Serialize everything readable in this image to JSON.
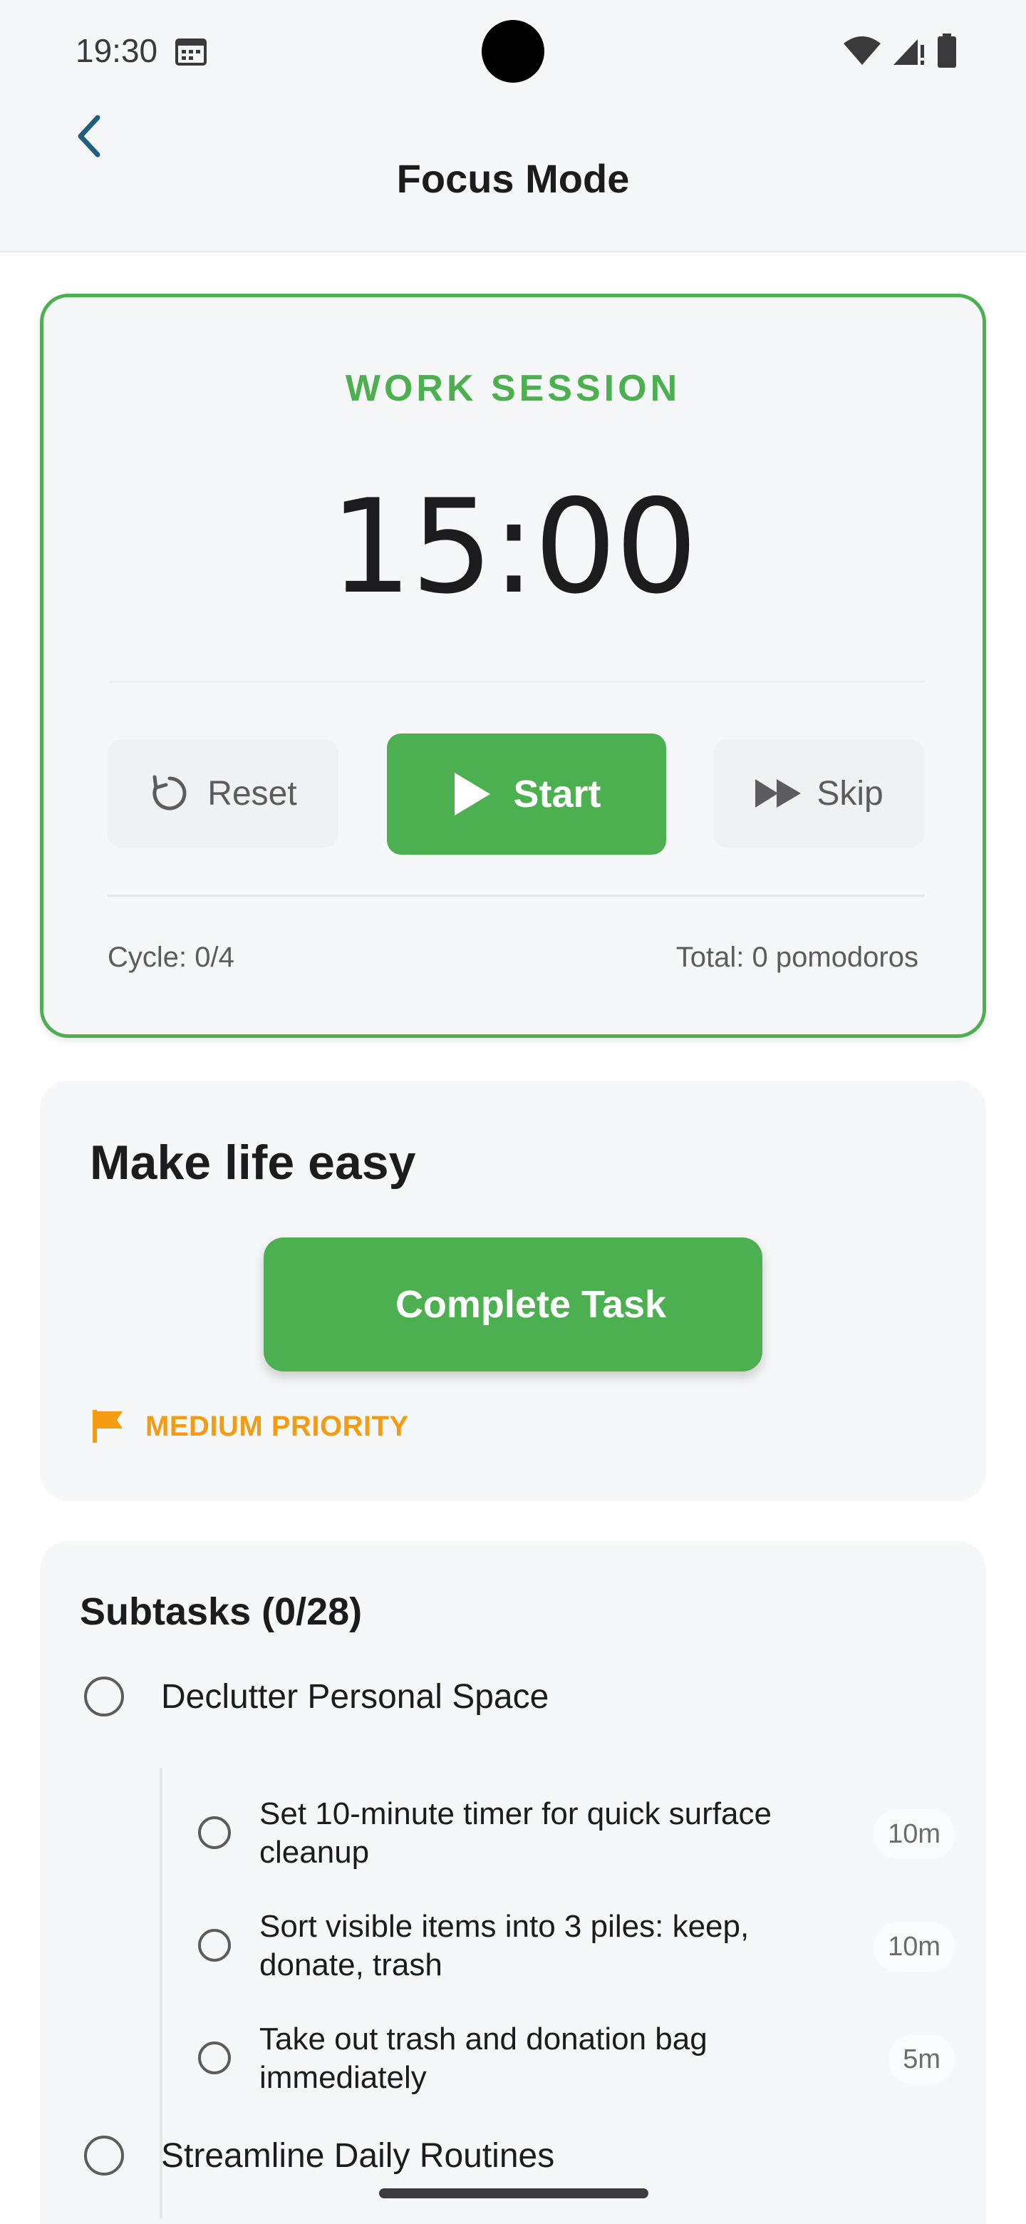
{
  "status_bar": {
    "time": "19:30",
    "icons": [
      "calendar-icon",
      "wifi-icon",
      "signal-icon",
      "battery-icon"
    ]
  },
  "app_bar": {
    "title": "Focus Mode",
    "back_icon": "chevron-left-icon"
  },
  "timer": {
    "session_label": "WORK SESSION",
    "time_remaining": "15:00",
    "reset_label": "Reset",
    "start_label": "Start",
    "skip_label": "Skip",
    "cycle_text": "Cycle: 0/4",
    "total_text": "Total: 0 pomodoros"
  },
  "task": {
    "title": "Make life easy",
    "complete_label": "Complete Task",
    "priority_label": "MEDIUM PRIORITY"
  },
  "subtasks": {
    "heading": "Subtasks (0/28)",
    "groups": [
      {
        "label": "Declutter Personal Space",
        "items": [
          {
            "text": "Set 10-minute timer for quick surface cleanup",
            "duration": "10m"
          },
          {
            "text": "Sort visible items into 3 piles: keep, donate, trash",
            "duration": "10m"
          },
          {
            "text": "Take out trash and donation bag immediately",
            "duration": "5m"
          }
        ]
      },
      {
        "label": "Streamline Daily Routines",
        "items": []
      }
    ]
  },
  "colors": {
    "accent_green": "#4caf50",
    "priority_orange": "#f39c12",
    "background": "#f6f7f9"
  }
}
